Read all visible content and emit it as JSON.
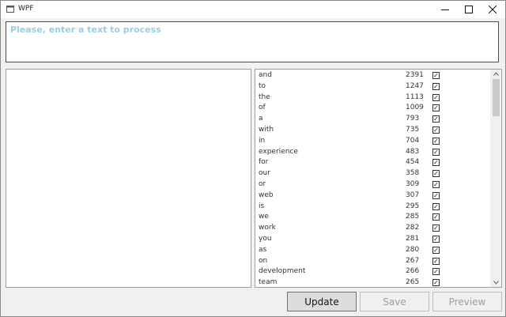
{
  "window": {
    "title": "WPF"
  },
  "input": {
    "placeholder": "Please, enter a text to process",
    "value": ""
  },
  "word_list": [
    {
      "word": "and",
      "count": "2391",
      "checked": true
    },
    {
      "word": "to",
      "count": "1247",
      "checked": true
    },
    {
      "word": "the",
      "count": "1113",
      "checked": true
    },
    {
      "word": "of",
      "count": "1009",
      "checked": true
    },
    {
      "word": "a",
      "count": "793",
      "checked": true
    },
    {
      "word": "with",
      "count": "735",
      "checked": true
    },
    {
      "word": "in",
      "count": "704",
      "checked": true
    },
    {
      "word": "experience",
      "count": "483",
      "checked": true
    },
    {
      "word": "for",
      "count": "454",
      "checked": true
    },
    {
      "word": "our",
      "count": "358",
      "checked": true
    },
    {
      "word": "or",
      "count": "309",
      "checked": true
    },
    {
      "word": "web",
      "count": "307",
      "checked": true
    },
    {
      "word": "is",
      "count": "295",
      "checked": true
    },
    {
      "word": "we",
      "count": "285",
      "checked": true
    },
    {
      "word": "work",
      "count": "282",
      "checked": true
    },
    {
      "word": "you",
      "count": "281",
      "checked": true
    },
    {
      "word": "as",
      "count": "280",
      "checked": true
    },
    {
      "word": "on",
      "count": "267",
      "checked": true
    },
    {
      "word": "development",
      "count": "266",
      "checked": true
    },
    {
      "word": "team",
      "count": "265",
      "checked": true
    }
  ],
  "buttons": {
    "update": "Update",
    "save": "Save",
    "preview": "Preview"
  }
}
